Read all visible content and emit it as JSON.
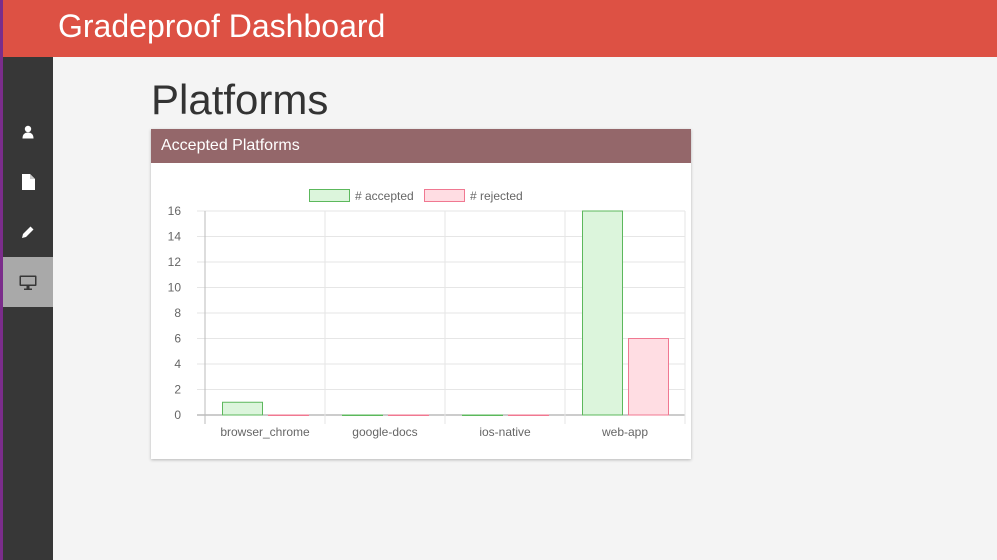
{
  "header": {
    "title": "Gradeproof Dashboard"
  },
  "sidebar": {
    "items": [
      {
        "icon": "user-icon",
        "active": false
      },
      {
        "icon": "file-icon",
        "active": false
      },
      {
        "icon": "pencil-icon",
        "active": false
      },
      {
        "icon": "desktop-icon",
        "active": true
      }
    ]
  },
  "page": {
    "title": "Platforms"
  },
  "panel": {
    "title": "Accepted Platforms"
  },
  "colors": {
    "header": "#dd5144",
    "sidebar": "#373737",
    "panel_header": "#94676a",
    "accepted_fill": "#dcf5dc",
    "accepted_border": "#5cb85c",
    "rejected_fill": "#ffdde3",
    "rejected_border": "#f07891"
  },
  "chart_data": {
    "type": "bar",
    "categories": [
      "browser_chrome",
      "google-docs",
      "ios-native",
      "web-app"
    ],
    "series": [
      {
        "name": "# accepted",
        "values": [
          1,
          0,
          0,
          16
        ]
      },
      {
        "name": "# rejected",
        "values": [
          0,
          0,
          0,
          6
        ]
      }
    ],
    "ylim": [
      0,
      16
    ],
    "yticks": [
      0,
      2,
      4,
      6,
      8,
      10,
      12,
      14,
      16
    ],
    "grid": true,
    "legend": "top"
  }
}
